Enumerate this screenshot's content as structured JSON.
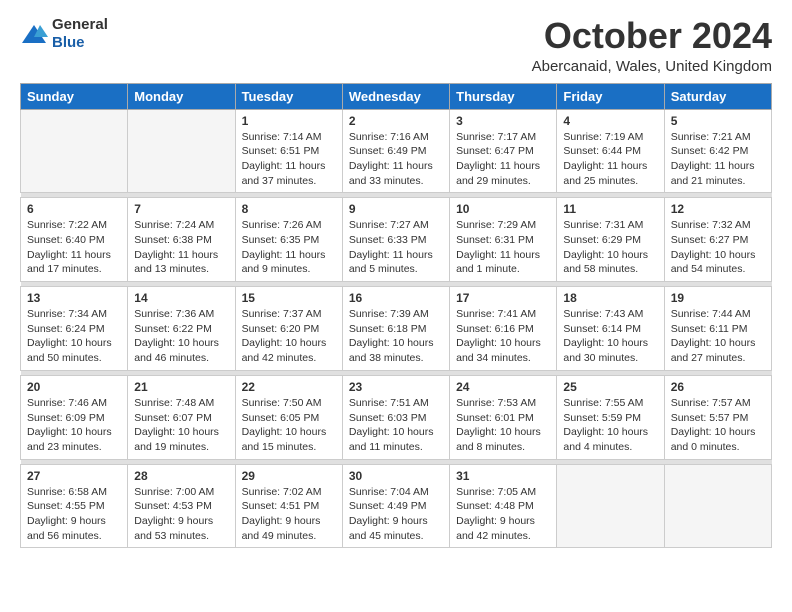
{
  "logo": {
    "general": "General",
    "blue": "Blue"
  },
  "header": {
    "title": "October 2024",
    "subtitle": "Abercanaid, Wales, United Kingdom"
  },
  "days_of_week": [
    "Sunday",
    "Monday",
    "Tuesday",
    "Wednesday",
    "Thursday",
    "Friday",
    "Saturday"
  ],
  "weeks": [
    [
      {
        "day": "",
        "info": ""
      },
      {
        "day": "",
        "info": ""
      },
      {
        "day": "1",
        "info": "Sunrise: 7:14 AM\nSunset: 6:51 PM\nDaylight: 11 hours\nand 37 minutes."
      },
      {
        "day": "2",
        "info": "Sunrise: 7:16 AM\nSunset: 6:49 PM\nDaylight: 11 hours\nand 33 minutes."
      },
      {
        "day": "3",
        "info": "Sunrise: 7:17 AM\nSunset: 6:47 PM\nDaylight: 11 hours\nand 29 minutes."
      },
      {
        "day": "4",
        "info": "Sunrise: 7:19 AM\nSunset: 6:44 PM\nDaylight: 11 hours\nand 25 minutes."
      },
      {
        "day": "5",
        "info": "Sunrise: 7:21 AM\nSunset: 6:42 PM\nDaylight: 11 hours\nand 21 minutes."
      }
    ],
    [
      {
        "day": "6",
        "info": "Sunrise: 7:22 AM\nSunset: 6:40 PM\nDaylight: 11 hours\nand 17 minutes."
      },
      {
        "day": "7",
        "info": "Sunrise: 7:24 AM\nSunset: 6:38 PM\nDaylight: 11 hours\nand 13 minutes."
      },
      {
        "day": "8",
        "info": "Sunrise: 7:26 AM\nSunset: 6:35 PM\nDaylight: 11 hours\nand 9 minutes."
      },
      {
        "day": "9",
        "info": "Sunrise: 7:27 AM\nSunset: 6:33 PM\nDaylight: 11 hours\nand 5 minutes."
      },
      {
        "day": "10",
        "info": "Sunrise: 7:29 AM\nSunset: 6:31 PM\nDaylight: 11 hours\nand 1 minute."
      },
      {
        "day": "11",
        "info": "Sunrise: 7:31 AM\nSunset: 6:29 PM\nDaylight: 10 hours\nand 58 minutes."
      },
      {
        "day": "12",
        "info": "Sunrise: 7:32 AM\nSunset: 6:27 PM\nDaylight: 10 hours\nand 54 minutes."
      }
    ],
    [
      {
        "day": "13",
        "info": "Sunrise: 7:34 AM\nSunset: 6:24 PM\nDaylight: 10 hours\nand 50 minutes."
      },
      {
        "day": "14",
        "info": "Sunrise: 7:36 AM\nSunset: 6:22 PM\nDaylight: 10 hours\nand 46 minutes."
      },
      {
        "day": "15",
        "info": "Sunrise: 7:37 AM\nSunset: 6:20 PM\nDaylight: 10 hours\nand 42 minutes."
      },
      {
        "day": "16",
        "info": "Sunrise: 7:39 AM\nSunset: 6:18 PM\nDaylight: 10 hours\nand 38 minutes."
      },
      {
        "day": "17",
        "info": "Sunrise: 7:41 AM\nSunset: 6:16 PM\nDaylight: 10 hours\nand 34 minutes."
      },
      {
        "day": "18",
        "info": "Sunrise: 7:43 AM\nSunset: 6:14 PM\nDaylight: 10 hours\nand 30 minutes."
      },
      {
        "day": "19",
        "info": "Sunrise: 7:44 AM\nSunset: 6:11 PM\nDaylight: 10 hours\nand 27 minutes."
      }
    ],
    [
      {
        "day": "20",
        "info": "Sunrise: 7:46 AM\nSunset: 6:09 PM\nDaylight: 10 hours\nand 23 minutes."
      },
      {
        "day": "21",
        "info": "Sunrise: 7:48 AM\nSunset: 6:07 PM\nDaylight: 10 hours\nand 19 minutes."
      },
      {
        "day": "22",
        "info": "Sunrise: 7:50 AM\nSunset: 6:05 PM\nDaylight: 10 hours\nand 15 minutes."
      },
      {
        "day": "23",
        "info": "Sunrise: 7:51 AM\nSunset: 6:03 PM\nDaylight: 10 hours\nand 11 minutes."
      },
      {
        "day": "24",
        "info": "Sunrise: 7:53 AM\nSunset: 6:01 PM\nDaylight: 10 hours\nand 8 minutes."
      },
      {
        "day": "25",
        "info": "Sunrise: 7:55 AM\nSunset: 5:59 PM\nDaylight: 10 hours\nand 4 minutes."
      },
      {
        "day": "26",
        "info": "Sunrise: 7:57 AM\nSunset: 5:57 PM\nDaylight: 10 hours\nand 0 minutes."
      }
    ],
    [
      {
        "day": "27",
        "info": "Sunrise: 6:58 AM\nSunset: 4:55 PM\nDaylight: 9 hours\nand 56 minutes."
      },
      {
        "day": "28",
        "info": "Sunrise: 7:00 AM\nSunset: 4:53 PM\nDaylight: 9 hours\nand 53 minutes."
      },
      {
        "day": "29",
        "info": "Sunrise: 7:02 AM\nSunset: 4:51 PM\nDaylight: 9 hours\nand 49 minutes."
      },
      {
        "day": "30",
        "info": "Sunrise: 7:04 AM\nSunset: 4:49 PM\nDaylight: 9 hours\nand 45 minutes."
      },
      {
        "day": "31",
        "info": "Sunrise: 7:05 AM\nSunset: 4:48 PM\nDaylight: 9 hours\nand 42 minutes."
      },
      {
        "day": "",
        "info": ""
      },
      {
        "day": "",
        "info": ""
      }
    ]
  ]
}
